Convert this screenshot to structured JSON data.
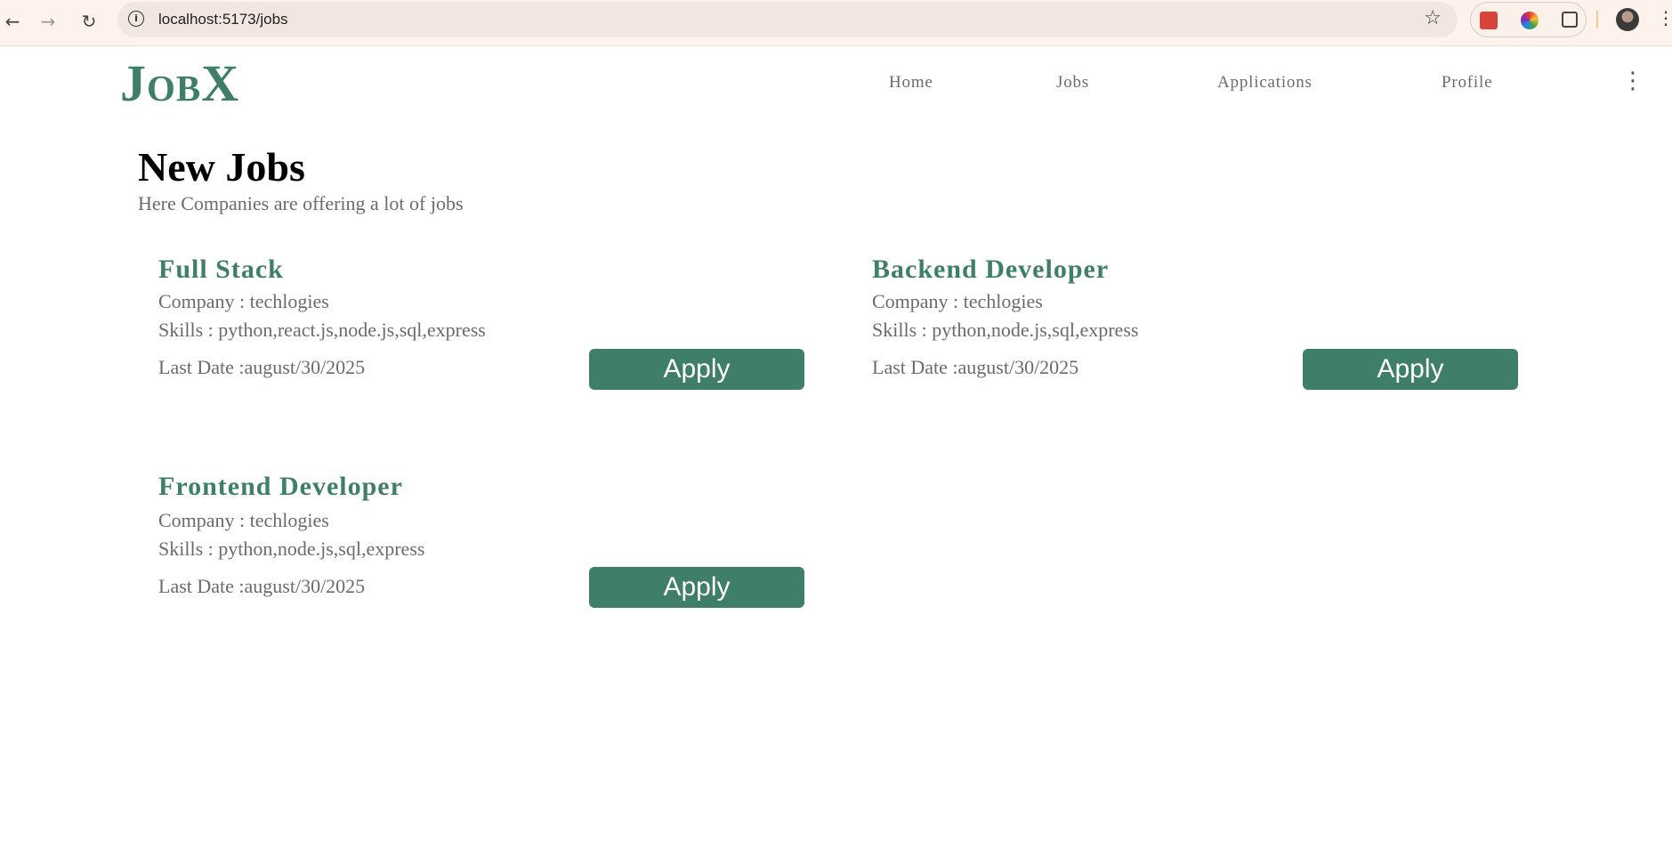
{
  "browser": {
    "url": "localhost:5173/jobs",
    "back_icon": "arrow-left-icon",
    "forward_icon": "arrow-right-icon",
    "reload_icon": "reload-icon",
    "info_icon": "i"
  },
  "header": {
    "logo": "JobX",
    "nav": [
      "Home",
      "Jobs",
      "Applications",
      "Profile"
    ]
  },
  "main": {
    "title": "New Jobs",
    "subtitle": "Here Companies are offering a lot of jobs"
  },
  "jobs": [
    {
      "title": "Full Stack",
      "company": "Company : techlogies",
      "skills": "Skills : python,react.js,node.js,sql,express",
      "last_date": "Last Date :august/30/2025",
      "apply_label": "Apply"
    },
    {
      "title": "Backend Developer",
      "company": "Company : techlogies",
      "skills": "Skills : python,node.js,sql,express",
      "last_date": "Last Date :august/30/2025",
      "apply_label": "Apply"
    },
    {
      "title": "Frontend Developer",
      "company": "Company : techlogies",
      "skills": "Skills : python,node.js,sql,express",
      "last_date": "Last Date :august/30/2025",
      "apply_label": "Apply"
    }
  ],
  "colors": {
    "brand": "#3f7f69",
    "text_muted": "#6b6b6b",
    "browser_bar": "#fdf2ec"
  }
}
